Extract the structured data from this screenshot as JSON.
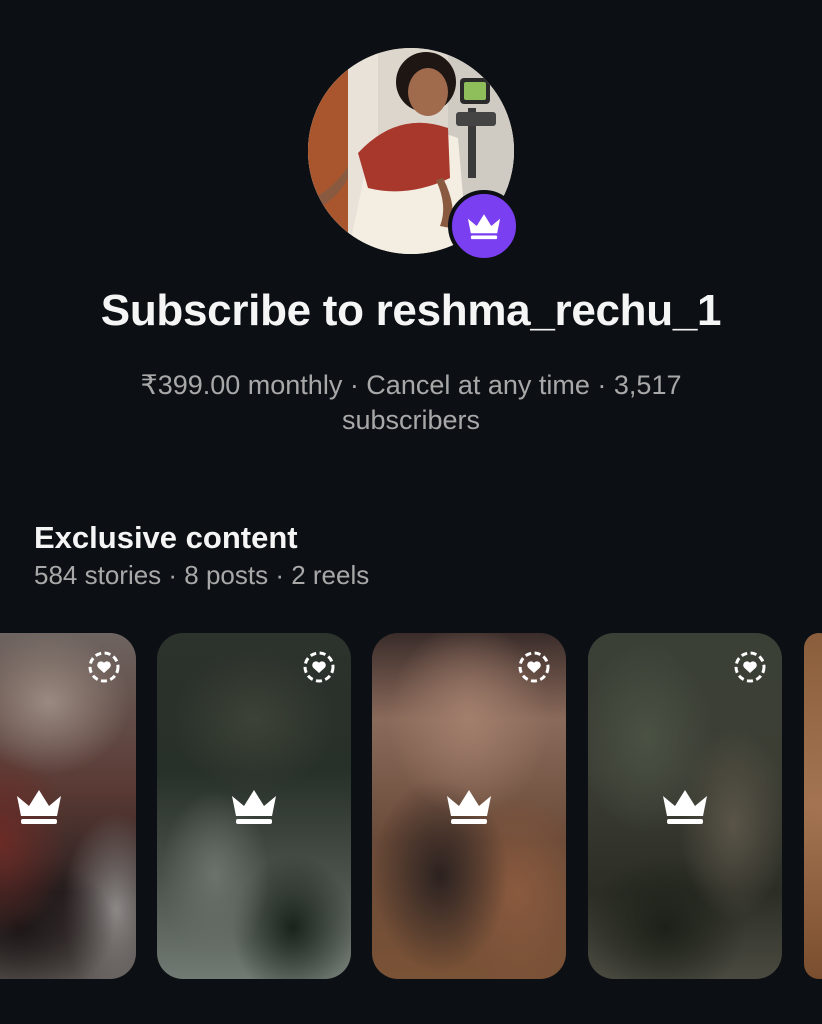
{
  "profile": {
    "username": "reshma_rechu_1",
    "avatar_alt": "profile photo",
    "badge_icon": "crown-icon",
    "badge_color": "#7b3ff2"
  },
  "header": {
    "title": "Subscribe to reshma_rechu_1",
    "subtitle": "₹399.00 monthly · Cancel at any time · 3,517 subscribers"
  },
  "exclusive": {
    "title": "Exclusive content",
    "meta": "584 stories · 8 posts · 2 reels",
    "cards": [
      {
        "type": "story",
        "locked_icon": "crown-icon",
        "corner_icon": "close-friends-story-icon"
      },
      {
        "type": "story",
        "locked_icon": "crown-icon",
        "corner_icon": "close-friends-story-icon"
      },
      {
        "type": "story",
        "locked_icon": "crown-icon",
        "corner_icon": "close-friends-story-icon"
      },
      {
        "type": "story",
        "locked_icon": "crown-icon",
        "corner_icon": "close-friends-story-icon"
      },
      {
        "type": "story",
        "locked_icon": "crown-icon",
        "corner_icon": "close-friends-story-icon"
      }
    ]
  },
  "colors": {
    "background": "#0c1014",
    "primary_text": "#f5f5f5",
    "secondary_text": "#a8a8a8",
    "accent": "#7b3ff2"
  }
}
